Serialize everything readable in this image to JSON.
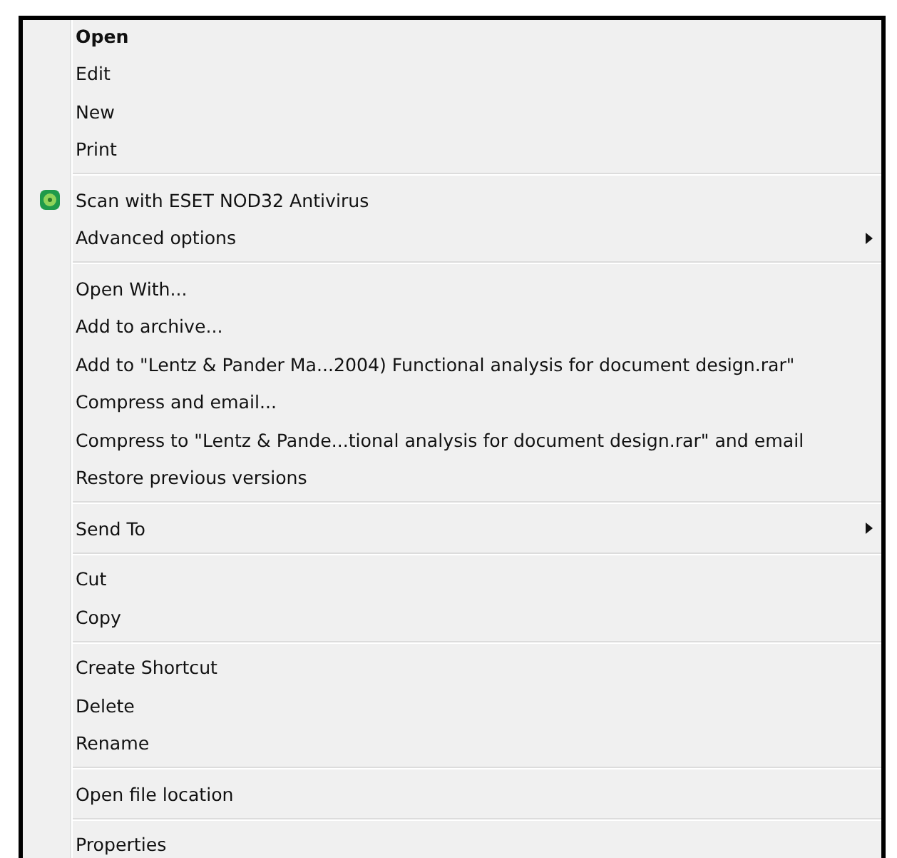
{
  "context_menu": {
    "groups": [
      {
        "items": [
          {
            "label": "Open",
            "default": true
          },
          {
            "label": "Edit",
            "default": false
          },
          {
            "label": "New",
            "default": false
          },
          {
            "label": "Print",
            "default": false
          }
        ]
      },
      {
        "items": [
          {
            "label": "Scan with ESET NOD32 Antivirus",
            "default": false,
            "has_icon": true
          },
          {
            "label": "Advanced options",
            "default": false,
            "submenu": true
          }
        ]
      },
      {
        "items": [
          {
            "label": "Open With...",
            "default": false
          },
          {
            "label": "Add to archive...",
            "default": false
          },
          {
            "label": "Add to \"Lentz & Pander Ma...2004) Functional analysis for document design.rar\"",
            "default": false
          },
          {
            "label": "Compress and email...",
            "default": false
          },
          {
            "label": "Compress to \"Lentz & Pande...tional analysis for document design.rar\" and email",
            "default": false
          },
          {
            "label": "Restore previous versions",
            "default": false
          }
        ]
      },
      {
        "items": [
          {
            "label": "Send To",
            "default": false,
            "submenu": true
          }
        ]
      },
      {
        "items": [
          {
            "label": "Cut",
            "default": false
          },
          {
            "label": "Copy",
            "default": false
          }
        ]
      },
      {
        "items": [
          {
            "label": "Create Shortcut",
            "default": false
          },
          {
            "label": "Delete",
            "default": false
          },
          {
            "label": "Rename",
            "default": false
          }
        ]
      },
      {
        "items": [
          {
            "label": "Open file location",
            "default": false
          }
        ]
      },
      {
        "items": [
          {
            "label": "Properties",
            "default": false
          }
        ]
      }
    ]
  }
}
